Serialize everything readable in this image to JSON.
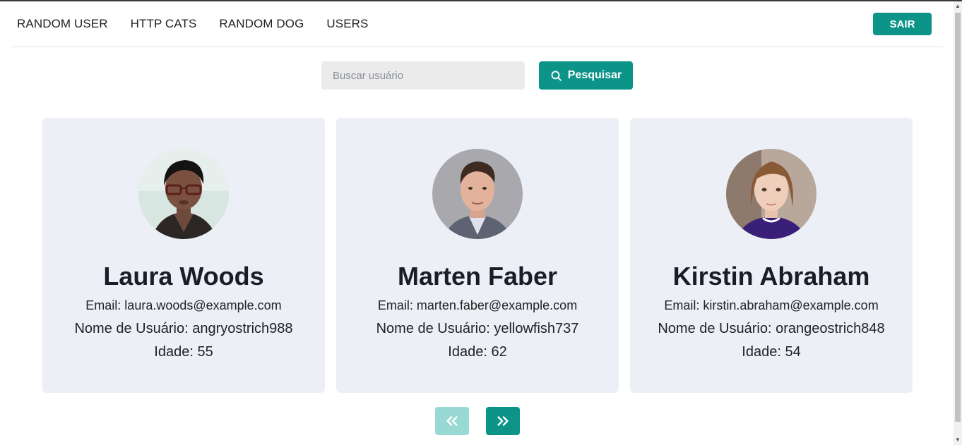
{
  "nav": {
    "links": [
      "RANDOM USER",
      "HTTP CATS",
      "RANDOM DOG",
      "USERS"
    ],
    "logout_label": "SAIR"
  },
  "search": {
    "placeholder": "Buscar usuário",
    "value": "",
    "button_label": "Pesquisar"
  },
  "users": [
    {
      "name": "Laura Woods",
      "email": "Email: laura.woods@example.com",
      "username": "Nome de Usuário: angryostrich988",
      "age": "Idade: 55"
    },
    {
      "name": "Marten Faber",
      "email": "Email: marten.faber@example.com",
      "username": "Nome de Usuário: yellowfish737",
      "age": "Idade: 62"
    },
    {
      "name": "Kirstin Abraham",
      "email": "Email: kirstin.abraham@example.com",
      "username": "Nome de Usuário: orangeostrich848",
      "age": "Idade: 54"
    }
  ],
  "pagination": {
    "prev_icon": "chevrons-left-icon",
    "next_icon": "chevrons-right-icon",
    "prev_disabled": true
  },
  "colors": {
    "accent": "#0d9488",
    "accent_disabled": "#99d9d4",
    "card_bg": "#eceff6"
  }
}
